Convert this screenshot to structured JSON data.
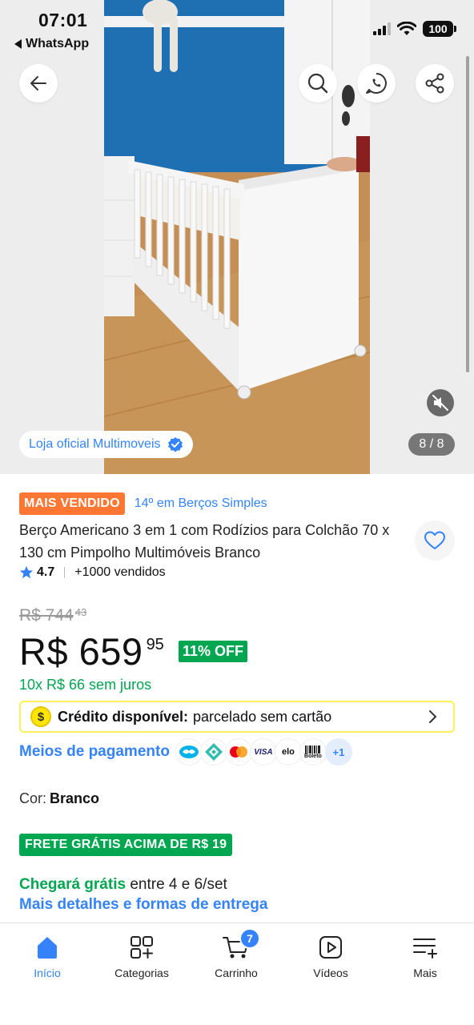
{
  "status_bar": {
    "time": "07:01",
    "back_app": "WhatsApp",
    "battery": "100",
    "icons": [
      "cellular-signal-icon",
      "wifi-icon",
      "battery-icon"
    ]
  },
  "gallery": {
    "store_label": "Loja oficial Multimoveis",
    "counter": "8 / 8",
    "header_buttons": [
      "back-arrow-icon",
      "search-icon",
      "whatsapp-share-icon",
      "share-icon"
    ]
  },
  "product": {
    "best_seller_badge": "MAIS VENDIDO",
    "rank_text": "14º em Berços Simples",
    "title": "Berço Americano 3 em 1 com Rodízios para Colchão 70 x 130 cm Pimpolho Multimóveis Branco",
    "rating": "4.7",
    "sold": "+1000 vendidos",
    "old_price_main": "R$ 744",
    "old_price_cents": "43",
    "price_main": "R$ 659",
    "price_cents": "95",
    "discount": "11% OFF",
    "installments": "10x R$ 66 sem juros"
  },
  "credit": {
    "coin": "$",
    "bold": "Crédito disponível:",
    "text": "parcelado sem cartão"
  },
  "payment": {
    "link": "Meios de pagamento",
    "logos": [
      "mercado-pago-icon",
      "pix-icon",
      "mastercard-icon",
      "visa-icon",
      "elo-icon",
      "boleto-icon"
    ],
    "visa": "VISA",
    "elo": "elo",
    "boleto": "Boleto",
    "more": "+1"
  },
  "color": {
    "label": "Cor:",
    "value": "Branco"
  },
  "shipping": {
    "badge": "FRETE GRÁTIS ACIMA DE R$ 19",
    "arrival_green": "Chegará grátis",
    "arrival_rest": " entre 4 e 6/set",
    "details_link": "Mais detalhes e formas de entrega"
  },
  "bottom_nav": {
    "items": [
      {
        "label": "Início",
        "icon": "home-icon"
      },
      {
        "label": "Categorias",
        "icon": "categories-icon"
      },
      {
        "label": "Carrinho",
        "icon": "cart-icon"
      },
      {
        "label": "Vídeos",
        "icon": "video-icon"
      },
      {
        "label": "Mais",
        "icon": "menu-plus-icon"
      }
    ],
    "cart_count": "7"
  },
  "colors": {
    "accent_blue": "#3483fa",
    "green": "#00a650",
    "orange": "#ff7733",
    "yellow": "#fff159"
  }
}
